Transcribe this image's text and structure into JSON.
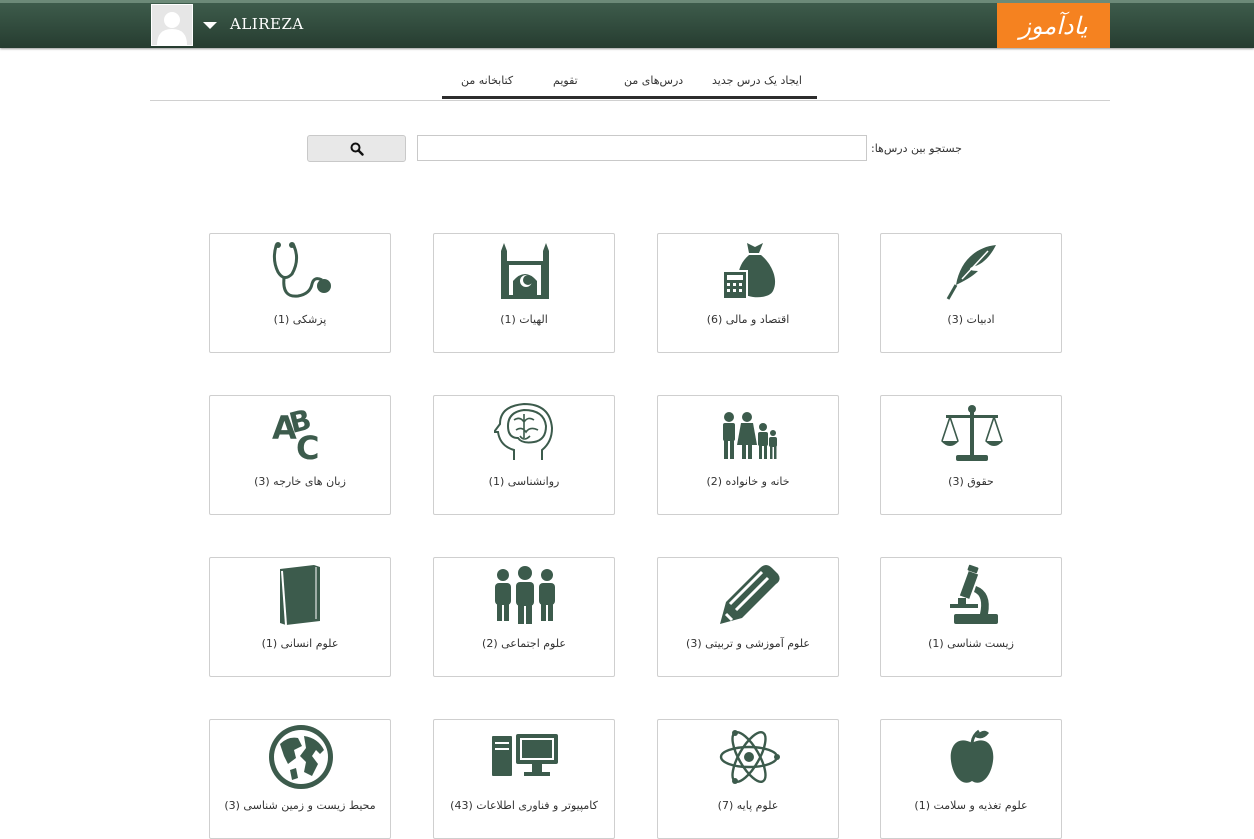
{
  "header": {
    "user_name": "ALIREZA",
    "logo_text": "یادآموز",
    "colors": {
      "bar": "#2f4b3c",
      "logo": "#f58220",
      "icon": "#3c5b4c"
    }
  },
  "tabs": [
    {
      "label": "ایجاد یک درس جدید"
    },
    {
      "label": "درس‌های من"
    },
    {
      "label": "تقویم"
    },
    {
      "label": "کتابخانه من"
    }
  ],
  "search": {
    "label": "جستجو بین درس‌ها:",
    "value": "",
    "button_icon": "search-icon"
  },
  "categories": [
    {
      "label": "ادبیات (3)",
      "icon": "feather-icon"
    },
    {
      "label": "اقتصاد و مالی (6)",
      "icon": "money-bag-calculator-icon"
    },
    {
      "label": "الهیات (1)",
      "icon": "mosque-icon"
    },
    {
      "label": "پزشکی (1)",
      "icon": "stethoscope-icon"
    },
    {
      "label": "حقوق (3)",
      "icon": "scales-icon"
    },
    {
      "label": "خانه و خانواده (2)",
      "icon": "family-icon"
    },
    {
      "label": "روانشناسی (1)",
      "icon": "brain-head-icon"
    },
    {
      "label": "زبان های خارجه (3)",
      "icon": "abc-icon"
    },
    {
      "label": "زیست شناسی (1)",
      "icon": "microscope-icon"
    },
    {
      "label": "علوم آموزشی و تربیتی (3)",
      "icon": "pencil-icon"
    },
    {
      "label": "علوم اجتماعی (2)",
      "icon": "people-group-icon"
    },
    {
      "label": "علوم انسانی (1)",
      "icon": "book-icon"
    },
    {
      "label": "علوم تغذیه و سلامت (1)",
      "icon": "apple-icon"
    },
    {
      "label": "علوم پایه (7)",
      "icon": "atom-icon"
    },
    {
      "label": "کامپیوتر و فناوری اطلاعات (43)",
      "icon": "computer-icon"
    },
    {
      "label": "محیط زیست و زمین شناسی (3)",
      "icon": "globe-icon"
    }
  ]
}
